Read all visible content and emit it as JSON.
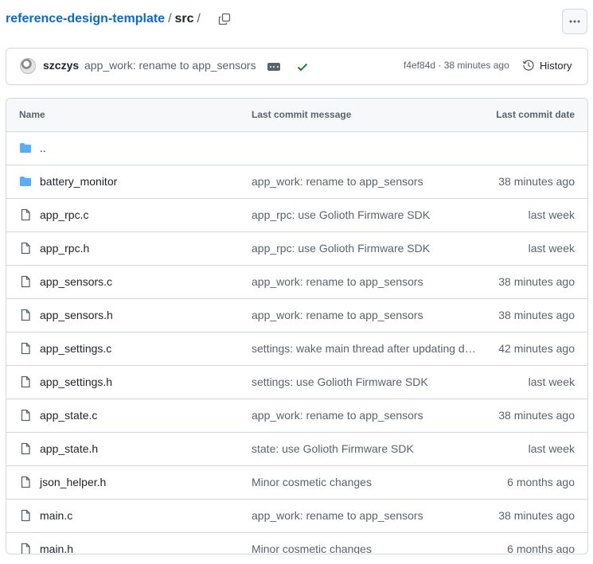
{
  "breadcrumb": {
    "repo": "reference-design-template",
    "separator": "/",
    "dir": "src",
    "trailing": "/"
  },
  "latest_commit": {
    "author": "szczys",
    "message": "app_work: rename to app_sensors",
    "sha_time": "f4ef84d · 38 minutes ago",
    "history_label": "History"
  },
  "table": {
    "headers": {
      "name": "Name",
      "message": "Last commit message",
      "date": "Last commit date"
    },
    "rows": [
      {
        "type": "folder",
        "name": "..",
        "message": "",
        "date": ""
      },
      {
        "type": "folder",
        "name": "battery_monitor",
        "message": "app_work: rename to app_sensors",
        "date": "38 minutes ago"
      },
      {
        "type": "file",
        "name": "app_rpc.c",
        "message": "app_rpc: use Golioth Firmware SDK",
        "date": "last week"
      },
      {
        "type": "file",
        "name": "app_rpc.h",
        "message": "app_rpc: use Golioth Firmware SDK",
        "date": "last week"
      },
      {
        "type": "file",
        "name": "app_sensors.c",
        "message": "app_work: rename to app_sensors",
        "date": "38 minutes ago"
      },
      {
        "type": "file",
        "name": "app_sensors.h",
        "message": "app_work: rename to app_sensors",
        "date": "38 minutes ago"
      },
      {
        "type": "file",
        "name": "app_settings.c",
        "message": "settings: wake main thread after updating d…",
        "date": "42 minutes ago"
      },
      {
        "type": "file",
        "name": "app_settings.h",
        "message": "settings: use Golioth Firmware SDK",
        "date": "last week"
      },
      {
        "type": "file",
        "name": "app_state.c",
        "message": "app_work: rename to app_sensors",
        "date": "38 minutes ago"
      },
      {
        "type": "file",
        "name": "app_state.h",
        "message": "state: use Golioth Firmware SDK",
        "date": "last week"
      },
      {
        "type": "file",
        "name": "json_helper.h",
        "message": "Minor cosmetic changes",
        "date": "6 months ago"
      },
      {
        "type": "file",
        "name": "main.c",
        "message": "app_work: rename to app_sensors",
        "date": "38 minutes ago"
      },
      {
        "type": "file",
        "name": "main.h",
        "message": "Minor cosmetic changes",
        "date": "6 months ago"
      }
    ]
  },
  "colors": {
    "link": "#0969da",
    "folder": "#54aeff",
    "success": "#1a7f37",
    "muted": "#59636e",
    "border": "#d1d9e0"
  },
  "icons": {
    "folder": "file-directory-icon",
    "file": "file-icon",
    "copy": "copy-icon",
    "history": "history-icon",
    "more": "kebab-horizontal-icon",
    "check": "check-icon"
  }
}
